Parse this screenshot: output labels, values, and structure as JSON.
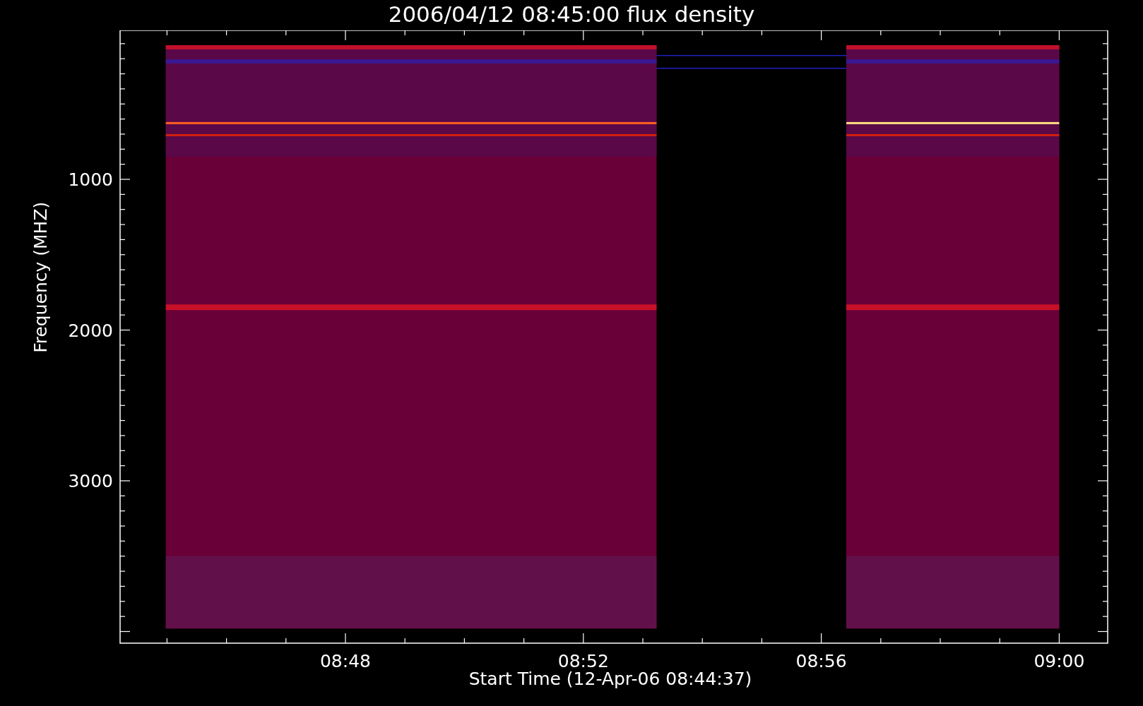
{
  "title": "2006/04/12 08:45:00 flux density",
  "y_axis": {
    "label": "Frequency (MHZ)",
    "ticks": [
      "1000",
      "2000",
      "3000"
    ]
  },
  "x_axis": {
    "label": "Start Time (12-Apr-06 08:44:37)",
    "ticks": [
      "08:48",
      "08:52",
      "08:56",
      "09:00"
    ]
  }
}
